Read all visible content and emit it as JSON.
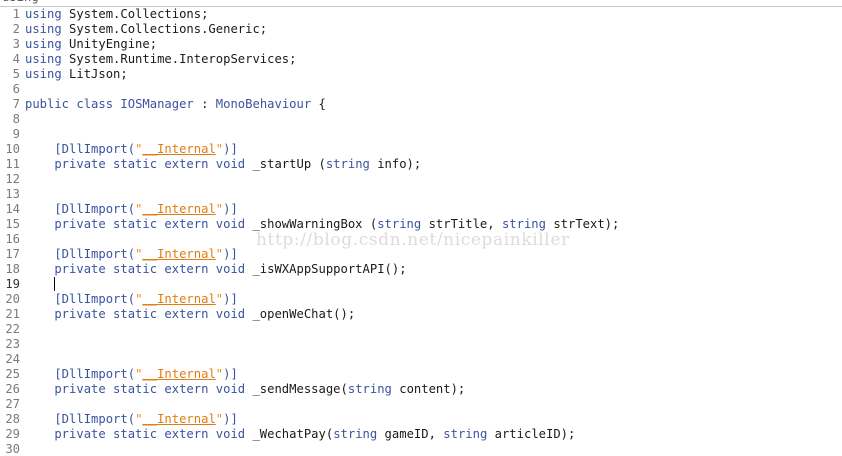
{
  "top_sliver_text": "using",
  "watermark": "http://blog.csdn.net/nicepainkiller",
  "current_line": 19,
  "lines": [
    {
      "n": "1",
      "tokens": [
        {
          "t": "using",
          "c": "kw"
        },
        {
          "t": " System.Collections;",
          "c": "plain"
        }
      ]
    },
    {
      "n": "2",
      "tokens": [
        {
          "t": "using",
          "c": "kw"
        },
        {
          "t": " System.Collections.Generic;",
          "c": "plain"
        }
      ]
    },
    {
      "n": "3",
      "tokens": [
        {
          "t": "using",
          "c": "kw"
        },
        {
          "t": " UnityEngine;",
          "c": "plain"
        }
      ]
    },
    {
      "n": "4",
      "tokens": [
        {
          "t": "using",
          "c": "kw"
        },
        {
          "t": " System.Runtime.InteropServices;",
          "c": "plain"
        }
      ]
    },
    {
      "n": "5",
      "tokens": [
        {
          "t": "using",
          "c": "kw"
        },
        {
          "t": " LitJson;",
          "c": "plain"
        }
      ]
    },
    {
      "n": "6",
      "tokens": []
    },
    {
      "n": "7",
      "tokens": [
        {
          "t": "public class",
          "c": "kw"
        },
        {
          "t": " IOSManager",
          "c": "type"
        },
        {
          "t": " : ",
          "c": "plain"
        },
        {
          "t": "MonoBehaviour",
          "c": "type"
        },
        {
          "t": " {",
          "c": "plain"
        }
      ]
    },
    {
      "n": "8",
      "tokens": []
    },
    {
      "n": "9",
      "tokens": []
    },
    {
      "n": "10",
      "tokens": [
        {
          "t": "    [DllImport(",
          "c": "attr"
        },
        {
          "t": "\"",
          "c": "str-q"
        },
        {
          "t": "__Internal",
          "c": "str-u"
        },
        {
          "t": "\"",
          "c": "str-q"
        },
        {
          "t": ")]",
          "c": "attr"
        }
      ]
    },
    {
      "n": "11",
      "tokens": [
        {
          "t": "    private static extern void",
          "c": "kw"
        },
        {
          "t": " _startUp (",
          "c": "plain"
        },
        {
          "t": "string",
          "c": "kw"
        },
        {
          "t": " info);",
          "c": "plain"
        }
      ]
    },
    {
      "n": "12",
      "tokens": []
    },
    {
      "n": "13",
      "tokens": []
    },
    {
      "n": "14",
      "tokens": [
        {
          "t": "    [DllImport(",
          "c": "attr"
        },
        {
          "t": "\"",
          "c": "str-q"
        },
        {
          "t": "__Internal",
          "c": "str-u"
        },
        {
          "t": "\"",
          "c": "str-q"
        },
        {
          "t": ")]",
          "c": "attr"
        }
      ]
    },
    {
      "n": "15",
      "tokens": [
        {
          "t": "    private static extern void",
          "c": "kw"
        },
        {
          "t": " _showWarningBox (",
          "c": "plain"
        },
        {
          "t": "string",
          "c": "kw"
        },
        {
          "t": " strTitle, ",
          "c": "plain"
        },
        {
          "t": "string",
          "c": "kw"
        },
        {
          "t": " strText);",
          "c": "plain"
        }
      ]
    },
    {
      "n": "16",
      "tokens": []
    },
    {
      "n": "17",
      "tokens": [
        {
          "t": "    [DllImport(",
          "c": "attr"
        },
        {
          "t": "\"",
          "c": "str-q"
        },
        {
          "t": "__Internal",
          "c": "str-u"
        },
        {
          "t": "\"",
          "c": "str-q"
        },
        {
          "t": ")]",
          "c": "attr"
        }
      ]
    },
    {
      "n": "18",
      "tokens": [
        {
          "t": "    private static extern void",
          "c": "kw"
        },
        {
          "t": " _isWXAppSupportAPI();",
          "c": "plain"
        }
      ]
    },
    {
      "n": "19",
      "tokens": []
    },
    {
      "n": "20",
      "tokens": [
        {
          "t": "    [DllImport(",
          "c": "attr"
        },
        {
          "t": "\"",
          "c": "str-q"
        },
        {
          "t": "__Internal",
          "c": "str-u"
        },
        {
          "t": "\"",
          "c": "str-q"
        },
        {
          "t": ")]",
          "c": "attr"
        }
      ]
    },
    {
      "n": "21",
      "tokens": [
        {
          "t": "    private static extern void",
          "c": "kw"
        },
        {
          "t": " _openWeChat();",
          "c": "plain"
        }
      ]
    },
    {
      "n": "22",
      "tokens": []
    },
    {
      "n": "23",
      "tokens": []
    },
    {
      "n": "24",
      "tokens": []
    },
    {
      "n": "25",
      "tokens": [
        {
          "t": "    [DllImport(",
          "c": "attr"
        },
        {
          "t": "\"",
          "c": "str-q"
        },
        {
          "t": "__Internal",
          "c": "str-u"
        },
        {
          "t": "\"",
          "c": "str-q"
        },
        {
          "t": ")]",
          "c": "attr"
        }
      ]
    },
    {
      "n": "26",
      "tokens": [
        {
          "t": "    private static extern void",
          "c": "kw"
        },
        {
          "t": " _sendMessage(",
          "c": "plain"
        },
        {
          "t": "string",
          "c": "kw"
        },
        {
          "t": " content);",
          "c": "plain"
        }
      ]
    },
    {
      "n": "27",
      "tokens": []
    },
    {
      "n": "28",
      "tokens": [
        {
          "t": "    [DllImport(",
          "c": "attr"
        },
        {
          "t": "\"",
          "c": "str-q"
        },
        {
          "t": "__Internal",
          "c": "str-u"
        },
        {
          "t": "\"",
          "c": "str-q"
        },
        {
          "t": ")]",
          "c": "attr"
        }
      ]
    },
    {
      "n": "29",
      "tokens": [
        {
          "t": "    private static extern void",
          "c": "kw"
        },
        {
          "t": " _WechatPay(",
          "c": "plain"
        },
        {
          "t": "string",
          "c": "kw"
        },
        {
          "t": " gameID, ",
          "c": "plain"
        },
        {
          "t": "string",
          "c": "kw"
        },
        {
          "t": " articleID);",
          "c": "plain"
        }
      ]
    },
    {
      "n": "30",
      "tokens": []
    }
  ]
}
